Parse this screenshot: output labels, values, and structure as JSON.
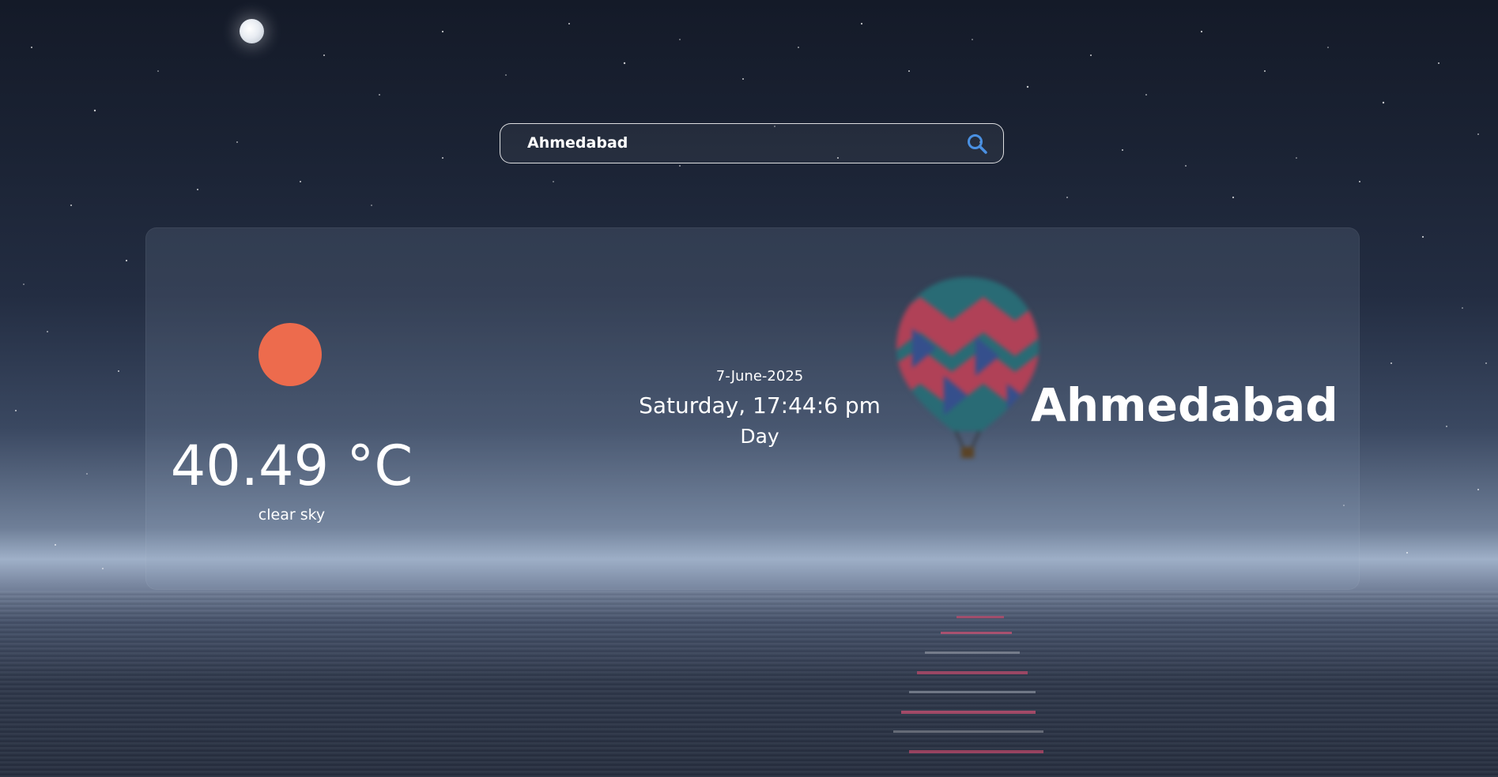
{
  "search": {
    "value": "Ahmedabad",
    "icon": "search-icon"
  },
  "weather": {
    "icon": "sun-icon",
    "temperature": "40.49 °C",
    "condition": "clear sky",
    "date": "7-June-2025",
    "time": "Saturday, 17:44:6 pm",
    "period": "Day",
    "city": "Ahmedabad"
  },
  "colors": {
    "sun": "#ed6b4d",
    "search_icon": "#4a90e2",
    "text": "#ffffff"
  }
}
